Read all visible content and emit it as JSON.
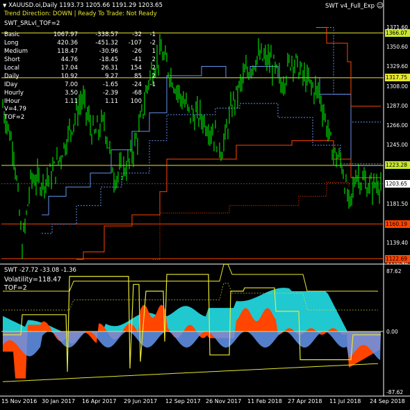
{
  "header": {
    "symbol_line": "XAUUSD.oi,Daily  1193.73 1205.66 1191.29 1203.65",
    "indicator_name": "SWT v4_Full_Exp",
    "trend_line": "Trend Direction:  DOWN  |  Ready To Trade:  Not Ready",
    "srlvl_line": "SWT_SRLvl_TOF=2"
  },
  "table": {
    "rows": [
      {
        "label": "Basic",
        "a": "1067.97",
        "b": "-338.57",
        "c": "-32",
        "d": "-1"
      },
      {
        "label": "Long",
        "a": "420.36",
        "b": "-451.32",
        "c": "-107",
        "d": "-2"
      },
      {
        "label": "Medium",
        "a": "118.47",
        "b": "-30.96",
        "c": "-26",
        "d": "1"
      },
      {
        "label": "Short",
        "a": "44.76",
        "b": "-18.45",
        "c": "-41",
        "d": "2"
      },
      {
        "label": "Local",
        "a": "17.04",
        "b": "26.31",
        "c": "154",
        "d": "2"
      },
      {
        "label": "Daily",
        "a": "10.92",
        "b": "9.27",
        "c": "85",
        "d": "2"
      },
      {
        "label": "IDay",
        "a": "7.00",
        "b": "-1.65",
        "c": "-24",
        "d": "-1"
      },
      {
        "label": "Hourly",
        "a": "3.50",
        "b": "-2.39",
        "c": "-68",
        "d": ""
      },
      {
        "label": "IHour",
        "a": "1.11",
        "b": "1.11",
        "c": "100",
        "d": ""
      }
    ],
    "extra1": "V=4.79",
    "extra2": "TOF=2"
  },
  "price_axis": {
    "labels": [
      "1371.60",
      "1350.60",
      "1329.60",
      "1308.00",
      "1287.00",
      "1266.00",
      "1245.00",
      "1224.00",
      "1203.65",
      "1181.50",
      "1160.50",
      "1139.40",
      "1118.40"
    ],
    "tags": [
      {
        "value": "1366.07",
        "color": "#c8e830",
        "text_color": "#000000"
      },
      {
        "value": "1317.75",
        "color": "#e8e830",
        "text_color": "#000000"
      },
      {
        "value": "1223.28",
        "color": "#c8e830",
        "text_color": "#000000"
      },
      {
        "value": "1203.65",
        "color": "#ffffff",
        "text_color": "#000000"
      },
      {
        "value": "1160.19",
        "color": "#ff4500",
        "text_color": "#000000"
      },
      {
        "value": "1122.69",
        "color": "#ff4500",
        "text_color": "#000000"
      }
    ]
  },
  "lower_panel": {
    "title": "SWT -27.72 -33.08 -1.36",
    "volatility": "Volatility=118.47",
    "tof": "TOF=2",
    "axis": [
      "87.62",
      "0.00",
      "-87.62"
    ]
  },
  "dates": [
    "15 Nov 2016",
    "30 Jan 2017",
    "16 Apr 2017",
    "29 Jun 2017",
    "12 Sep 2017",
    "26 Nov 2017",
    "11 Feb 2018",
    "27 Apr 2018",
    "11 Jul 2018",
    "24 Sep 2018"
  ],
  "colors": {
    "candle": "#00ff00",
    "resistance": "#ff4500",
    "support_blue": "#6495ed",
    "level_yellow": "#e8e830",
    "cyan_area": "#20c8d0",
    "orange_area": "#ff4500",
    "blue_area": "#6495ed"
  }
}
